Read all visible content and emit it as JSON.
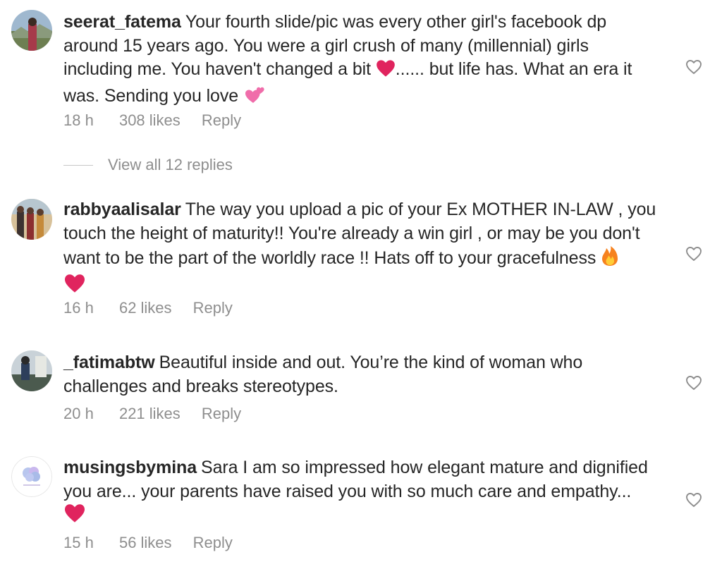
{
  "comments": [
    {
      "username": "seerat_fatema",
      "text_line1": "Your fourth slide/pic was every other girl's facebook dp",
      "text_line2": "around 15 years ago. You were a girl crush of many (millennial) girls",
      "text_line3_a": "including me. You haven't changed a bit ",
      "text_line3_b": "...... but life has. What an era it",
      "text_line4": "was. Sending you love ",
      "time": "18 h",
      "likes": "308 likes",
      "reply": "Reply",
      "icons": [
        "avatar",
        "red-heart-emoji",
        "two-hearts-emoji",
        "heart-outline-icon"
      ]
    },
    {
      "username": "rabbyaalisalar",
      "text_line1": "The way you upload a pic of your Ex MOTHER IN-LAW , you",
      "text_line2": "touch the height of maturity!! You're already a win girl , or may be you don't",
      "text_line3": "want to be the part of the worldly race !! Hats off to your gracefulness ",
      "time": "16 h",
      "likes": "62 likes",
      "reply": "Reply",
      "icons": [
        "avatar",
        "fire-emoji",
        "red-heart-emoji",
        "heart-outline-icon"
      ]
    },
    {
      "username": "_fatimabtw",
      "text_line1": "Beautiful inside and out. You’re the kind of woman who",
      "text_line2": "challenges and breaks stereotypes.",
      "time": "20 h",
      "likes": "221 likes",
      "reply": "Reply",
      "icons": [
        "avatar",
        "heart-outline-icon"
      ]
    },
    {
      "username": "musingsbymina",
      "text_line1": "Sara I am so impressed how elegant mature and dignified",
      "text_line2": "you are... your parents have raised you with so much care and empathy...",
      "time": "15 h",
      "likes": "56 likes",
      "reply": "Reply",
      "icons": [
        "avatar",
        "red-heart-emoji",
        "heart-outline-icon"
      ]
    }
  ],
  "view_replies": "View all 12 replies",
  "colors": {
    "text": "#262626",
    "secondary": "#8e8e8e",
    "heart_red": "#e0245e",
    "divider": "#c7c7c7"
  }
}
